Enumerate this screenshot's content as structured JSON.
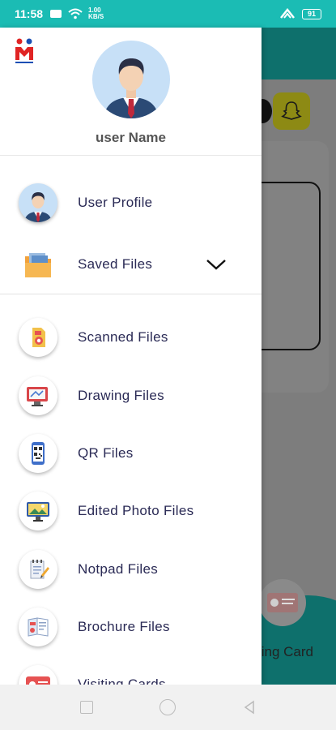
{
  "status_bar": {
    "time": "11:58",
    "network_rate": "1.00 KB/S",
    "battery": "91"
  },
  "drawer": {
    "user_name": "user Name",
    "profile_item": {
      "label": "User Profile",
      "icon": "user-avatar-icon"
    },
    "saved_files": {
      "label": "Saved Files",
      "icon": "folder-icon",
      "expanded": false
    },
    "files": [
      {
        "label": "Scanned Files",
        "icon": "scan-doc-icon"
      },
      {
        "label": "Drawing Files",
        "icon": "drawing-icon"
      },
      {
        "label": "QR Files",
        "icon": "qr-phone-icon"
      },
      {
        "label": "Edited Photo Files",
        "icon": "photo-edit-icon"
      },
      {
        "label": "Notpad Files",
        "icon": "notepad-icon"
      },
      {
        "label": "Brochure Files",
        "icon": "brochure-icon"
      },
      {
        "label": "Visiting Cards",
        "icon": "visiting-card-icon"
      }
    ]
  },
  "background": {
    "visiting_card_label": "ting Card"
  },
  "colors": {
    "status_bar": "#1bbcb4",
    "menu_text": "#2a2a55",
    "logo_red": "#e02424"
  }
}
